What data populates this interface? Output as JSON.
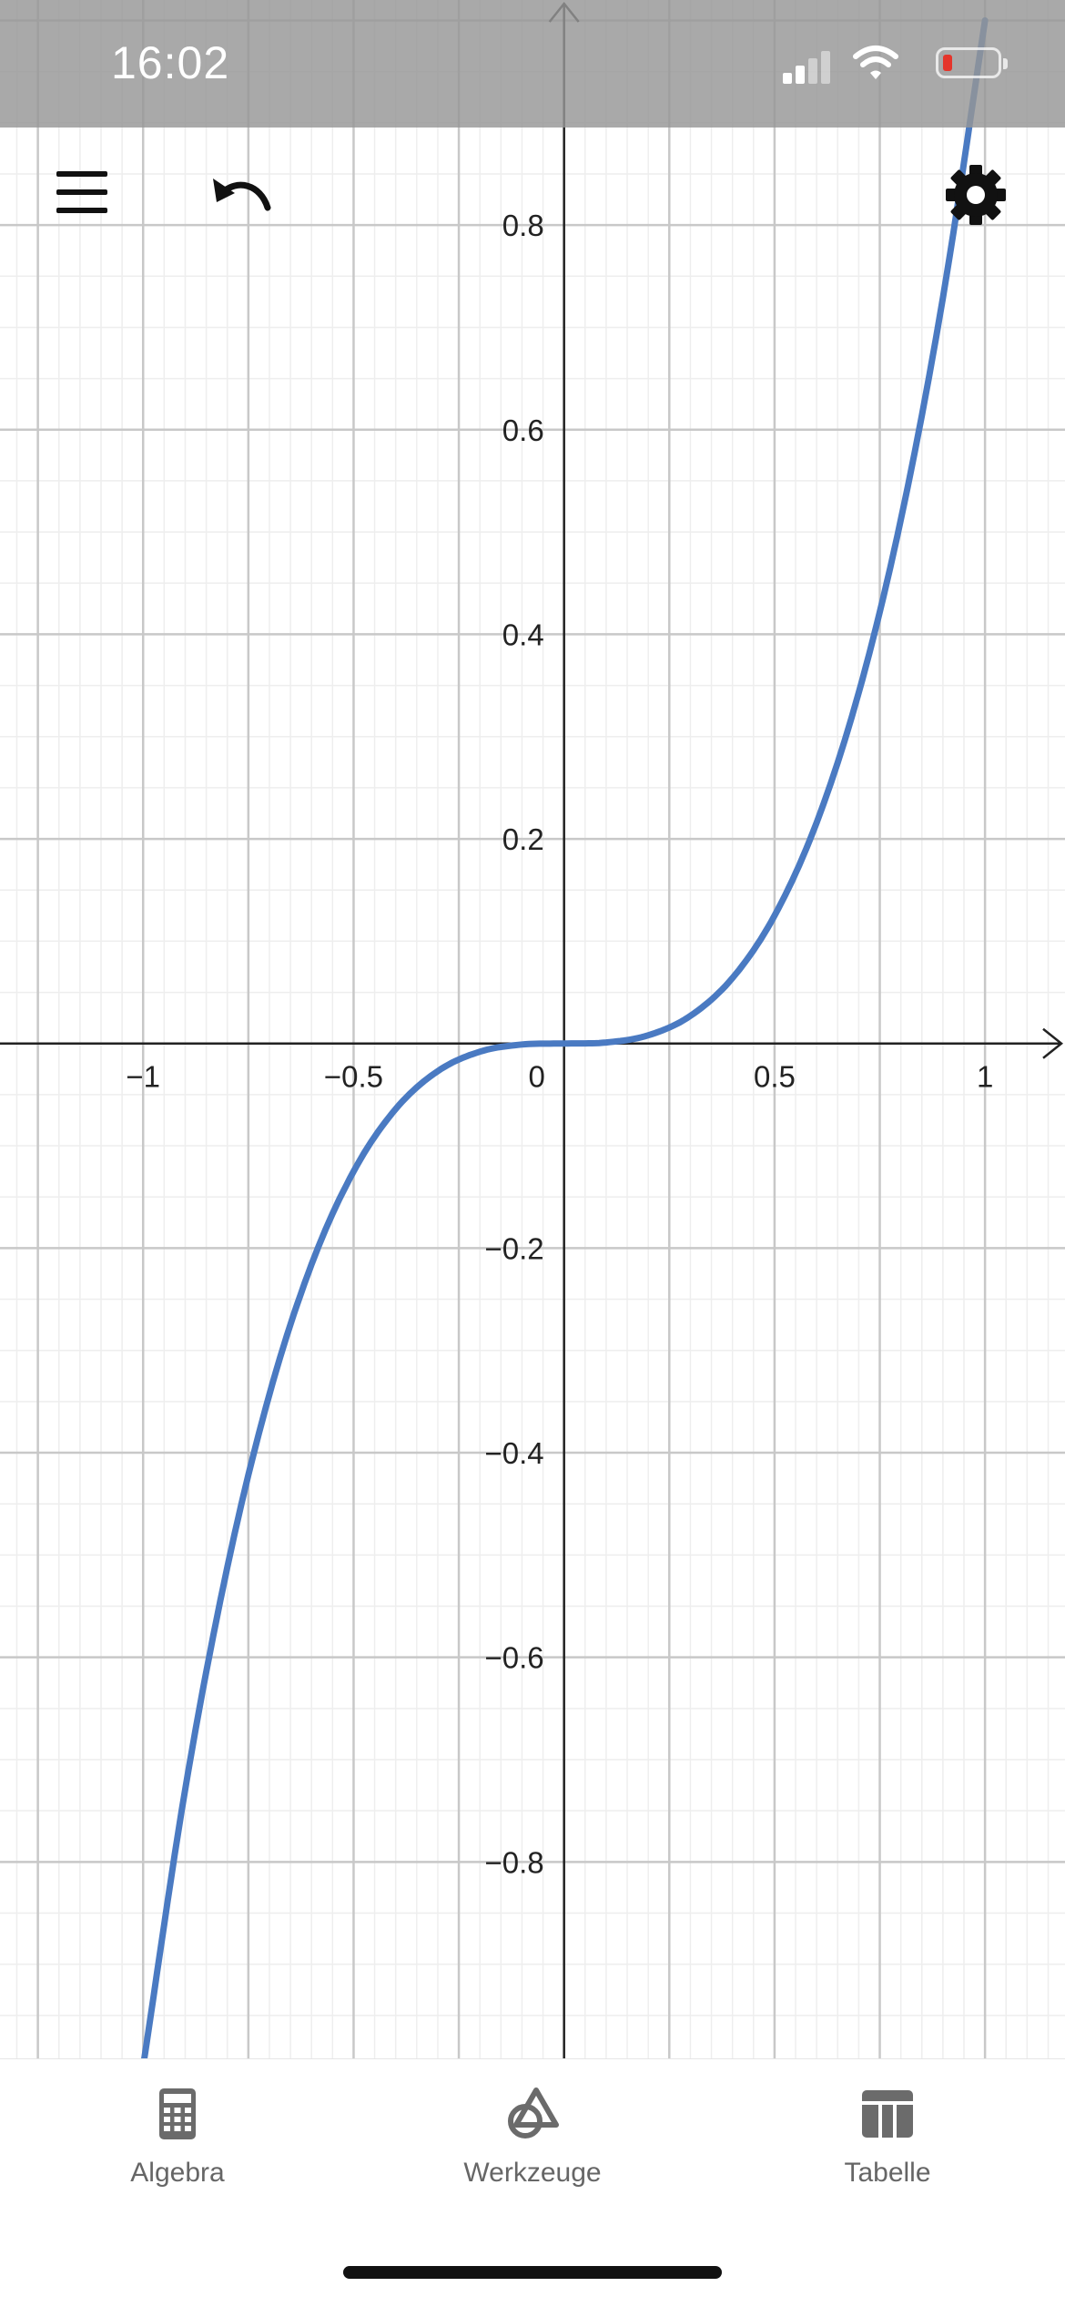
{
  "status_bar": {
    "time": "16:02",
    "icons": [
      "cellular-signal-icon",
      "wifi-icon",
      "battery-low-icon"
    ],
    "battery_color": "#e5352b"
  },
  "toolbar": {
    "menu_icon": "hamburger-menu-icon",
    "undo_icon": "undo-icon",
    "settings_icon": "gear-icon"
  },
  "chart_data": {
    "type": "line",
    "function": "y = x^3",
    "series": [
      {
        "x": [
          -1.0,
          -0.9,
          -0.8,
          -0.7,
          -0.6,
          -0.5,
          -0.4,
          -0.3,
          -0.2,
          -0.1,
          0,
          0.1,
          0.2,
          0.3,
          0.4,
          0.5,
          0.6,
          0.7,
          0.8,
          0.9,
          1.0
        ],
        "values": [
          -1.0,
          -0.729,
          -0.512,
          -0.343,
          -0.216,
          -0.125,
          -0.064,
          -0.027,
          -0.008,
          -0.001,
          0,
          0.001,
          0.008,
          0.027,
          0.064,
          0.125,
          0.216,
          0.343,
          0.512,
          0.729,
          1.0
        ],
        "color": "#4a7ac2"
      }
    ],
    "xlim": [
      -1.34,
      1.19
    ],
    "ylim": [
      -0.992,
      1.02
    ],
    "x_ticks": [
      -1,
      -0.5,
      0,
      0.5,
      1
    ],
    "x_tick_labels": [
      "−1",
      "−0.5",
      "0",
      "0.5",
      "1"
    ],
    "y_ticks": [
      -0.8,
      -0.6,
      -0.4,
      -0.2,
      0.2,
      0.4,
      0.6,
      0.8
    ],
    "y_tick_labels": [
      "−0.8",
      "−0.6",
      "−0.4",
      "−0.2",
      "0.2",
      "0.4",
      "0.6",
      "0.8"
    ],
    "grid": true,
    "colors": {
      "curve": "#4a7ac2",
      "major_grid": "#c8c8c8",
      "minor_grid": "#eeeeee",
      "axes": "#222222"
    }
  },
  "tab_bar": {
    "tabs": [
      {
        "label": "Algebra",
        "icon": "calculator-icon"
      },
      {
        "label": "Werkzeuge",
        "icon": "tools-shapes-icon"
      },
      {
        "label": "Tabelle",
        "icon": "table-icon"
      }
    ]
  }
}
